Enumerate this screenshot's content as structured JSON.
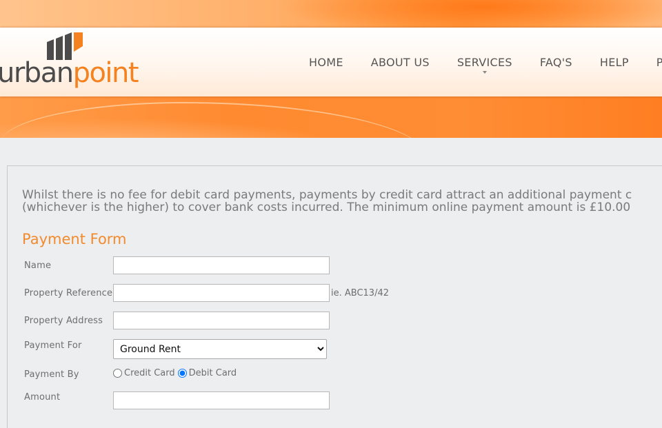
{
  "brand": {
    "name_part1": "urban",
    "name_part2": "point",
    "colors": {
      "accent": "#f58220",
      "text": "#4b4b4b"
    }
  },
  "nav": {
    "items": [
      {
        "label": "HOME"
      },
      {
        "label": "ABOUT US"
      },
      {
        "label": "SERVICES",
        "has_dropdown": true
      },
      {
        "label": "FAQ'S"
      },
      {
        "label": "HELP"
      },
      {
        "label": "PA"
      }
    ]
  },
  "notice": {
    "line1": "Whilst there is no fee for debit card payments, payments by credit card attract an additional payment c",
    "line2": "(whichever is the higher) to cover bank costs incurred. The minimum online payment amount is £10.00"
  },
  "form": {
    "title": "Payment Form",
    "name_label": "Name",
    "name_value": "",
    "property_reference_label": "Property Reference",
    "property_reference_value": "",
    "property_reference_hint": "ie. ABC13/42",
    "property_address_label": "Property Address",
    "property_address_value": "",
    "payment_for_label": "Payment For",
    "payment_for_selected": "Ground Rent",
    "payment_by_label": "Payment By",
    "payment_by_options": [
      {
        "label": "Credit Card",
        "checked": false
      },
      {
        "label": "Debit Card",
        "checked": true
      }
    ],
    "amount_label": "Amount",
    "amount_value": ""
  }
}
